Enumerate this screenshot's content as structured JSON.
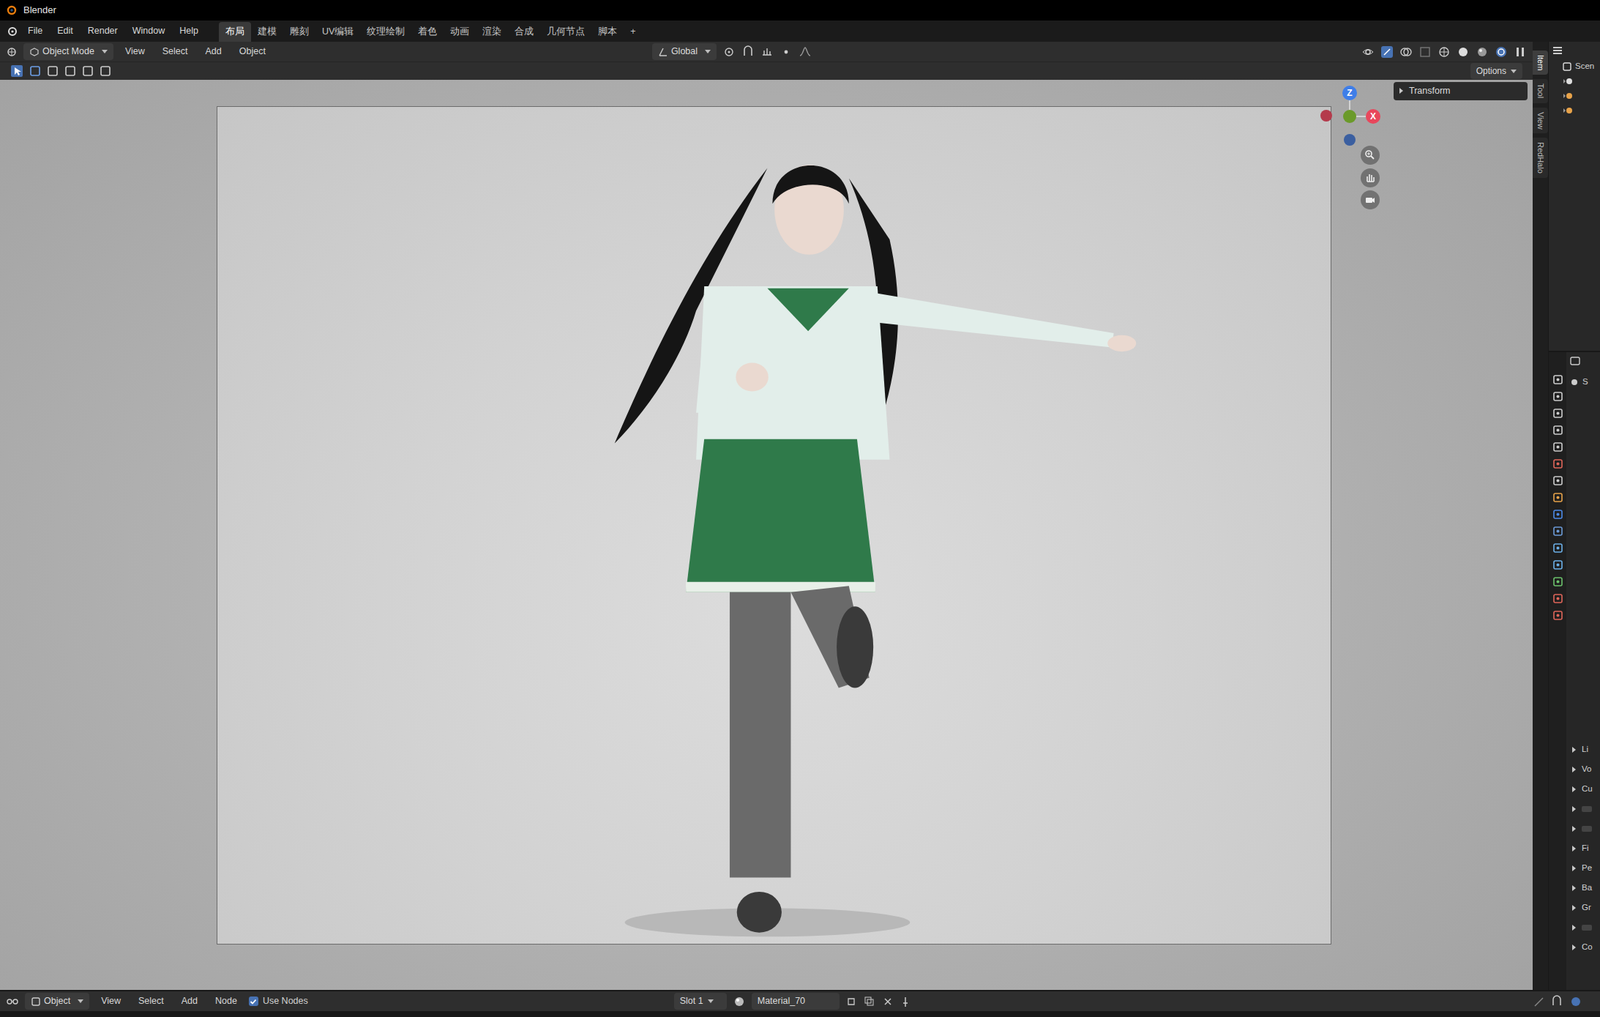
{
  "window": {
    "title": "Blender"
  },
  "menu": [
    "File",
    "Edit",
    "Render",
    "Window",
    "Help"
  ],
  "workspaces": [
    {
      "label": "布局",
      "selected": true
    },
    {
      "label": "建模",
      "selected": false
    },
    {
      "label": "雕刻",
      "selected": false
    },
    {
      "label": "UV编辑",
      "selected": false
    },
    {
      "label": "纹理绘制",
      "selected": false
    },
    {
      "label": "着色",
      "selected": false
    },
    {
      "label": "动画",
      "selected": false
    },
    {
      "label": "渲染",
      "selected": false
    },
    {
      "label": "合成",
      "selected": false
    },
    {
      "label": "几何节点",
      "selected": false
    },
    {
      "label": "脚本",
      "selected": false
    }
  ],
  "workspace_add": "+",
  "viewport_header": {
    "mode": "Object Mode",
    "menus": [
      "View",
      "Select",
      "Add",
      "Object"
    ],
    "orientation": "Global",
    "options": "Options"
  },
  "gizmo": {
    "z": "Z",
    "x": "X"
  },
  "transform_panel": {
    "label": "Transform",
    "expanded": false
  },
  "sidebar_tabs": [
    {
      "label": "Item",
      "selected": true
    },
    {
      "label": "Tool",
      "selected": false
    },
    {
      "label": "View",
      "selected": false
    },
    {
      "label": "RedHalo",
      "selected": false
    }
  ],
  "outliner": {
    "rows": [
      "Scen"
    ]
  },
  "properties": {
    "header": "S",
    "sections": [
      {
        "kind": "text",
        "label": "Li"
      },
      {
        "kind": "text",
        "label": "Vo"
      },
      {
        "kind": "text",
        "label": "Cu"
      },
      {
        "kind": "box"
      },
      {
        "kind": "box"
      },
      {
        "kind": "text",
        "label": "Fi"
      },
      {
        "kind": "text",
        "label": "Pe"
      },
      {
        "kind": "text",
        "label": "Ba"
      },
      {
        "kind": "text",
        "label": "Gr"
      },
      {
        "kind": "box"
      },
      {
        "kind": "text",
        "label": "Co"
      }
    ]
  },
  "node_header": {
    "editor": "Object",
    "menus": [
      "View",
      "Select",
      "Add",
      "Node"
    ],
    "use_nodes": {
      "label": "Use Nodes",
      "checked": true
    },
    "slot": "Slot 1",
    "material": "Material_70"
  }
}
